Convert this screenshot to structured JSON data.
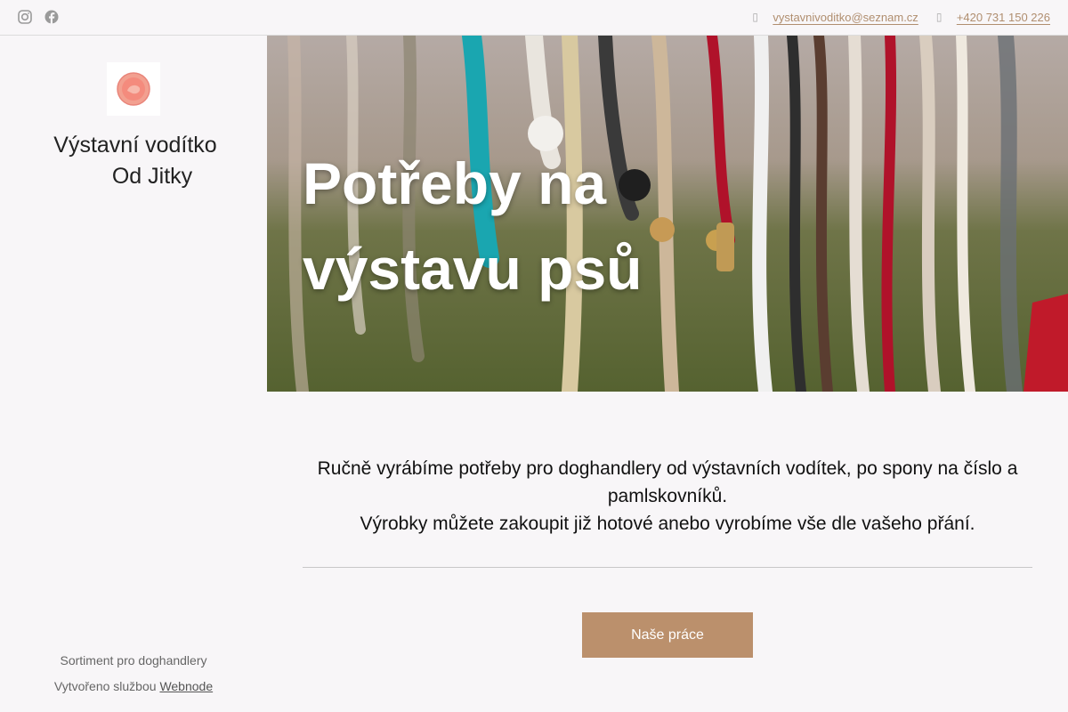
{
  "topbar": {
    "email": "vystavnivoditko@seznam.cz",
    "phone": "+420 731 150 226",
    "email_icon": "envelope-icon",
    "phone_icon": "phone-icon",
    "social": [
      "instagram-icon",
      "facebook-icon"
    ]
  },
  "sidebar": {
    "title_line1": "Výstavní vodítko",
    "title_line2": "Od Jitky",
    "footer_text": "Sortiment pro doghandlery",
    "credit_prefix": "Vytvořeno službou",
    "credit_link": "Webnode"
  },
  "hero": {
    "title_line1": "Potřeby na",
    "title_line2": "výstavu psů"
  },
  "main": {
    "intro_line1": "Ručně vyrábíme potřeby pro doghandlery od výstavních vodítek, po spony na číslo a pamlskovníků.",
    "intro_line2": "Výrobky můžete zakoupit již hotové anebo vyrobíme vše dle vašeho přání.",
    "cta_label": "Naše práce"
  },
  "colors": {
    "accent": "#bb906c",
    "link": "#b08e6f",
    "background": "#f8f6f8"
  }
}
